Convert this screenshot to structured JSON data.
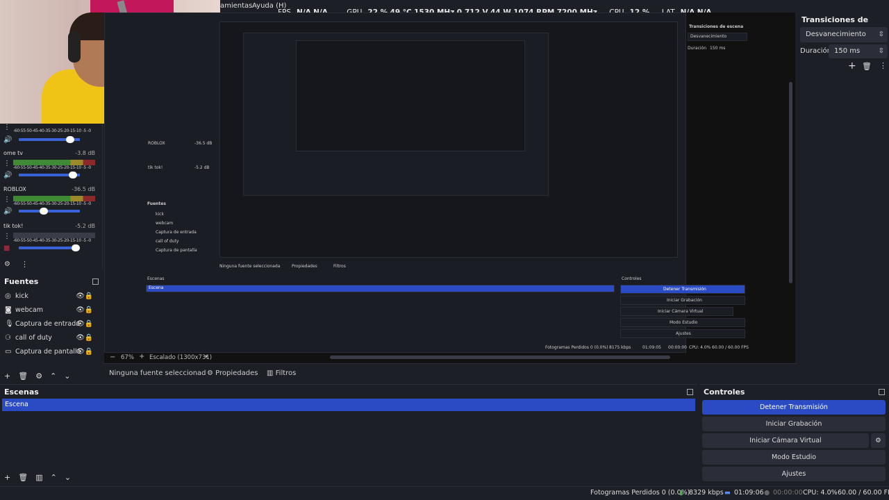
{
  "menu": {
    "item_tools": "amientas",
    "item_help": "Ayuda (H)"
  },
  "stats": {
    "fps_label": "FPS",
    "fps_value": "N/A",
    "fps_value2": "N/A",
    "gpu_label": "GPU",
    "gpu_load": "22 %",
    "gpu_temp": "49 °C",
    "gpu_clock": "1530 MHz",
    "gpu_voltage": "0.712 V",
    "gpu_power": "44 W",
    "gpu_fan": "1074 RPM",
    "gpu_mem_clock": "7200 MHz",
    "cpu_label": "CPU",
    "cpu_value": "12 %",
    "lat_label": "LAT",
    "lat_value": "N/A",
    "lat_value2": "N/A"
  },
  "mixer": {
    "scale": "-60-55-50-45-40-35-30-25-20-15-10 -5 -0",
    "channels": [
      {
        "name": "ome tv",
        "db": "-3.8 dB",
        "level": 0.7
      },
      {
        "name": "ROBLOX",
        "db": "-36.5 dB",
        "level": 0.33
      },
      {
        "name": "tik tok!",
        "db": "-5.2 dB",
        "level": 0.78
      }
    ],
    "first_level": 0.7
  },
  "sources": {
    "title": "Fuentes",
    "items": [
      {
        "name": "kick",
        "icon": "globe-icon"
      },
      {
        "name": "webcam",
        "icon": "camera-icon"
      },
      {
        "name": "Captura de entrada",
        "icon": "microphone-icon"
      },
      {
        "name": "call of duty",
        "icon": "gamepad-icon"
      },
      {
        "name": "Captura de pantalla",
        "icon": "monitor-icon"
      }
    ]
  },
  "preview": {
    "zoom": "67%",
    "scale_mode": "Escalado (1300x731)",
    "nested_scenes_title": "Escenas",
    "nested_scene": "Escena",
    "nested_controls_title": "Controles",
    "nested_controls": [
      "Detener Transmisión",
      "Iniciar Grabación",
      "Iniciar Cámara Virtual",
      "Modo Estudio",
      "Ajustes"
    ],
    "nested_transitions_title": "Transiciones de escena",
    "nested_transition": "Desvanecimiento",
    "nested_duration_label": "Duración",
    "nested_duration": "150 ms",
    "nested_status": "Fotogramas Perdidos 0 (0.0%)",
    "nested_kbps": "8175 kbps",
    "nested_time": "01:09:05",
    "nested_rec": "00:00:00",
    "nested_cpu": "CPU: 4.0%",
    "nested_fps": "60.00 / 60.00 FPS",
    "nested_no_source": "Ninguna fuente seleccionada",
    "nested_props": "Propiedades",
    "nested_filters": "Filtros",
    "nested_sources_title": "Fuentes",
    "nested_sources": [
      "kick",
      "webcam",
      "Captura de entrada",
      "call of duty",
      "Captura de pantalla"
    ],
    "nested_mixer": [
      {
        "name": "ROBLOX",
        "db": "-36.5 dB"
      },
      {
        "name": "tik tok!",
        "db": "-5.2 dB"
      }
    ]
  },
  "transitions": {
    "title": "Transiciones de escena",
    "selected": "Desvanecimiento",
    "duration_label": "Duración",
    "duration_value": "150 ms"
  },
  "propbar": {
    "no_source": "Ninguna fuente seleccionad",
    "properties": "Propiedades",
    "filters": "Filtros"
  },
  "scenes": {
    "title": "Escenas",
    "items": [
      "Escena"
    ]
  },
  "controls": {
    "title": "Controles",
    "stop_stream": "Detener Transmisión",
    "start_recording": "Iniciar Grabación",
    "start_virtual_cam": "Iniciar Cámara Virtual",
    "studio_mode": "Modo Estudio",
    "settings": "Ajustes"
  },
  "status": {
    "dropped_frames": "Fotogramas Perdidos 0 (0.0%)",
    "bitrate": "8329 kbps",
    "stream_time": "01:09:06",
    "rec_time": "00:00:00",
    "cpu": "CPU: 4.0%",
    "fps": "60.00 / 60.00 FPS"
  },
  "colors": {
    "accent": "#2b4bc4",
    "bg": "#1d1f26",
    "button": "#2b2e38"
  }
}
